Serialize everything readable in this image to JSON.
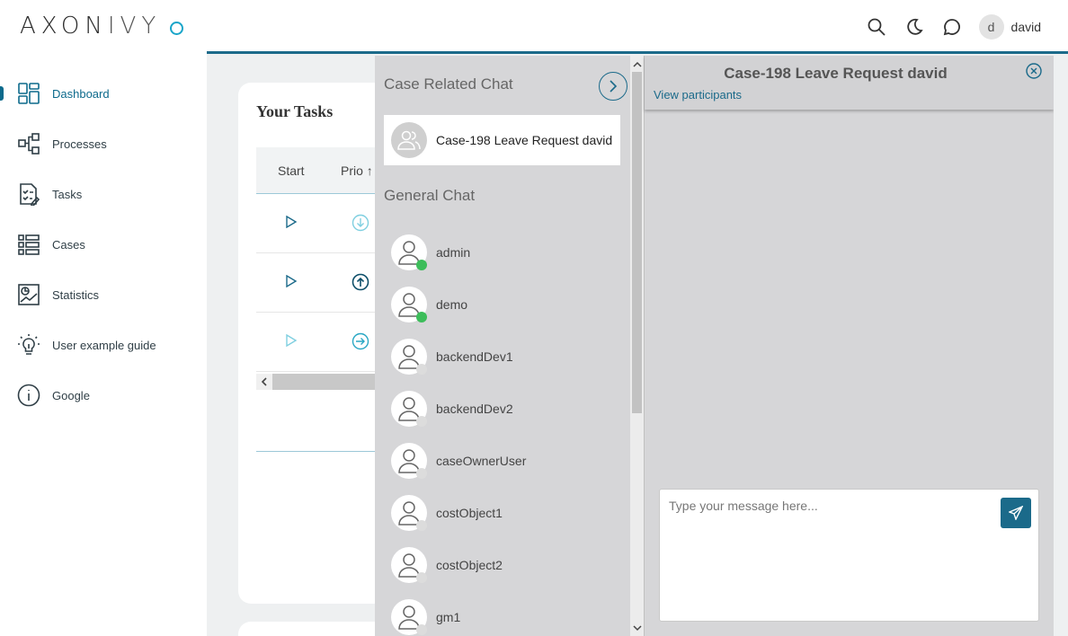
{
  "brand": {
    "name_main": "AXON",
    "name_sub": "IVY"
  },
  "sidebar": {
    "items": [
      {
        "label": "Dashboard",
        "icon": "dashboard-icon",
        "active": true
      },
      {
        "label": "Processes",
        "icon": "processes-icon"
      },
      {
        "label": "Tasks",
        "icon": "tasks-icon"
      },
      {
        "label": "Cases",
        "icon": "cases-icon"
      },
      {
        "label": "Statistics",
        "icon": "statistics-icon"
      },
      {
        "label": "User example guide",
        "icon": "lightbulb-icon"
      },
      {
        "label": "Google",
        "icon": "info-icon"
      }
    ]
  },
  "topbar": {
    "icons": [
      "search-icon",
      "moon-icon",
      "chat-icon"
    ],
    "user": {
      "initial": "d",
      "name": "david"
    }
  },
  "tasks_widget": {
    "title": "Your Tasks",
    "columns": [
      "Start",
      "Prio"
    ],
    "rows": [
      {
        "prio": "low"
      },
      {
        "prio": "high"
      },
      {
        "prio": "normal"
      }
    ]
  },
  "chat": {
    "case_section_title": "Case Related Chat",
    "case_chat_label": "Case-198 Leave Request david",
    "general_section_title": "General Chat",
    "contacts": [
      {
        "name": "admin",
        "online": true
      },
      {
        "name": "demo",
        "online": true
      },
      {
        "name": "backendDev1",
        "online": false
      },
      {
        "name": "backendDev2",
        "online": false
      },
      {
        "name": "caseOwnerUser",
        "online": false
      },
      {
        "name": "costObject1",
        "online": false
      },
      {
        "name": "costObject2",
        "online": false
      },
      {
        "name": "gm1",
        "online": false
      }
    ]
  },
  "conversation": {
    "title": "Case-198 Leave Request david",
    "participants_link": "View participants",
    "message_placeholder": "Type your message here..."
  },
  "colors": {
    "accent": "#1b6a8a",
    "online": "#3cbd5a",
    "brand_circle": "#19a5c9"
  }
}
